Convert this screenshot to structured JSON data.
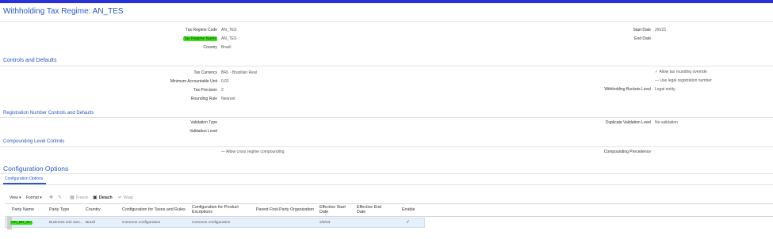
{
  "header": {
    "title": "Withholding Tax Regime: AN_TES"
  },
  "general": {
    "fields": [
      {
        "label": "Tax Regime Code",
        "value": "AN_TES"
      },
      {
        "label": "Tax Regime Name",
        "value": "AN_TES"
      },
      {
        "label": "Country",
        "value": "Brazil"
      }
    ],
    "right_fields": [
      {
        "label": "Start Date",
        "value": "2/6/23"
      },
      {
        "label": "End Date",
        "value": ""
      }
    ]
  },
  "controls": {
    "title": "Controls and Defaults",
    "fields": [
      {
        "label": "Tax Currency",
        "value": "BRL - Brazilian Real"
      },
      {
        "label": "Minimum Accountable Unit",
        "value": "0.01"
      },
      {
        "label": "Tax Precision",
        "value": "2"
      },
      {
        "label": "Rounding Rule",
        "value": "Nearest"
      }
    ],
    "checkboxes": [
      {
        "label": "Allow tax rounding override",
        "mark": "✓"
      },
      {
        "label": "Use legal registration number",
        "mark": "—"
      }
    ],
    "buckets_label": "Withholding Buckets Level",
    "buckets_value": "Legal entity"
  },
  "registration": {
    "title": "Registration Number Controls and Defaults",
    "validation_type_label": "Validation Type",
    "validation_level_label": "Validation Level",
    "duplicate_label": "Duplicate Validation Level",
    "duplicate_value": "No validation"
  },
  "compounding": {
    "title": "Compounding Level Controls",
    "allow_label": "Allow cross regime compounding",
    "allow_mark": "—",
    "precedence_label": "Compounding Precedence"
  },
  "config": {
    "title": "Configuration Options",
    "tab": "Configuration Options",
    "toolbar": {
      "view": "View",
      "format": "Format",
      "freeze": "Freeze",
      "detach": "Detach",
      "wrap": "Wrap"
    },
    "columns": [
      "Party Name",
      "Party Type",
      "Country",
      "Configuration for Taxes and Rules",
      "Configuration for Product Exceptions",
      "Parent First-Party Organization",
      "Effective Start Date",
      "Effective End Date",
      "Enable"
    ],
    "rows": [
      {
        "party_name": "OR_BR_BU",
        "party_type": "Business unit own...",
        "country": "Brazil",
        "taxes_rules": "Common configuration",
        "product_exceptions": "Common configuration",
        "parent_org": "",
        "start_date": "2/6/23",
        "end_date": "",
        "enable": "✓"
      }
    ]
  }
}
